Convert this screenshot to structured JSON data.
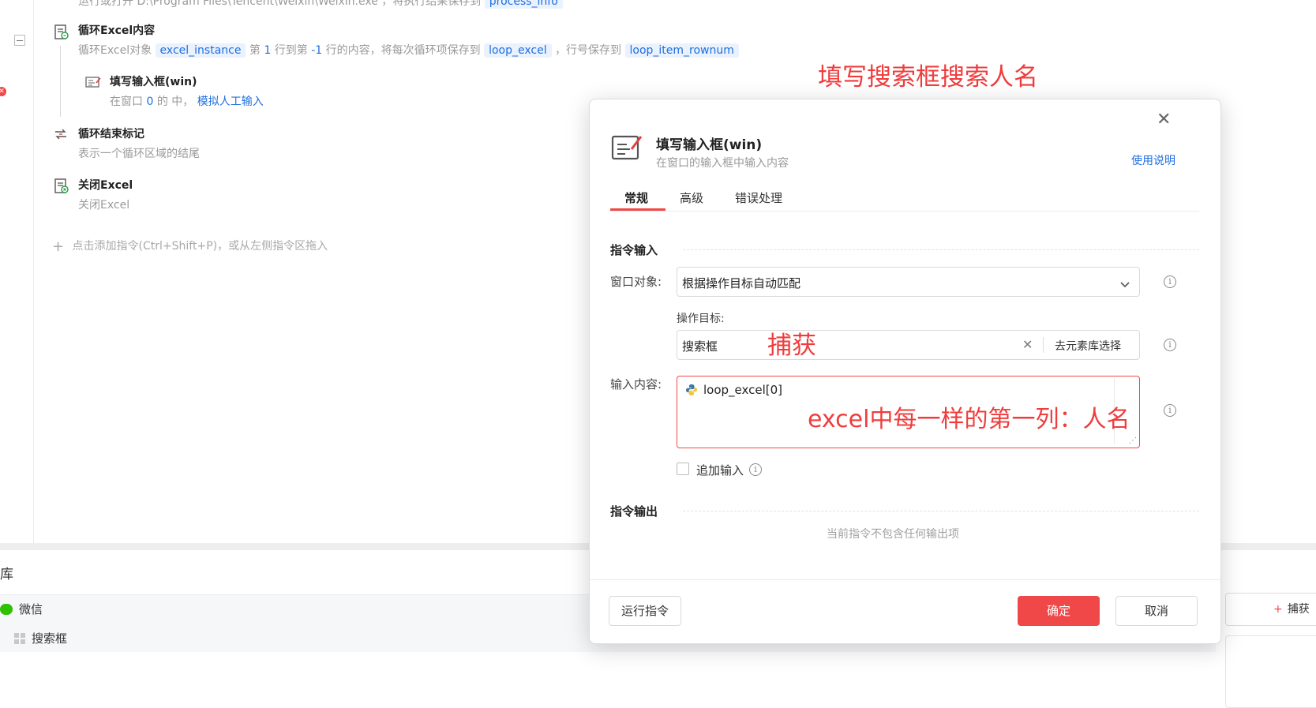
{
  "flow": {
    "top_cut_text": "运行或打开 D:\\Program Files\\Tencent\\Weixin\\Weixin.exe ，将执行结果保存到",
    "top_cut_chip": "process_info",
    "loop": {
      "title": "循环Excel内容",
      "desc_prefix": "循环Excel对象",
      "chip_obj": "excel_instance",
      "desc_mid1": "第",
      "row_start": "1",
      "desc_mid2": "行到第",
      "row_end": "-1",
      "desc_mid3": "行的内容，将每次循环项保存到",
      "chip_item": "loop_excel",
      "desc_mid4": "，行号保存到",
      "chip_rownum": "loop_item_rownum"
    },
    "fill_input": {
      "title": "填写输入框(win)",
      "desc_prefix": "在窗口",
      "window_num": "0",
      "desc_mid": "的 中，",
      "desc_link": "模拟人工输入"
    },
    "loop_end": {
      "title": "循环结束标记",
      "desc": "表示一个循环区域的结尾"
    },
    "close_excel": {
      "title": "关闭Excel",
      "desc": "关闭Excel"
    },
    "add_hint": "点击添加指令(Ctrl+Shift+P)，或从左侧指令区拖入"
  },
  "bottom": {
    "section_label": "库",
    "item_wechat": "微信",
    "item_search": "搜索框",
    "capture_btn": "捕获"
  },
  "dialog": {
    "title": "填写输入框(win)",
    "subtitle": "在窗口的输入框中输入内容",
    "help_link": "使用说明",
    "tabs": [
      "常规",
      "高级",
      "错误处理"
    ],
    "section_input": "指令输入",
    "window_label": "窗口对象:",
    "window_value": "根据操作目标自动匹配",
    "target_label": "操作目标:",
    "target_value": "搜索框",
    "target_select_btn": "去元素库选择",
    "content_label": "输入内容:",
    "content_value": "loop_excel[0]",
    "append_label": "追加输入",
    "section_output": "指令输出",
    "no_output": "当前指令不包含任何输出项",
    "run_btn": "运行指令",
    "ok_btn": "确定",
    "cancel_btn": "取消"
  },
  "annotations": {
    "title_note": "填写搜索框搜索人名",
    "capture_note": "捕获",
    "content_note": "excel中每一样的第一列：人名"
  },
  "colors": {
    "accent_blue": "#1f6fe0",
    "danger_red": "#f04848",
    "annotation_red": "#f03c3c",
    "wechat_green": "#2dc100"
  }
}
